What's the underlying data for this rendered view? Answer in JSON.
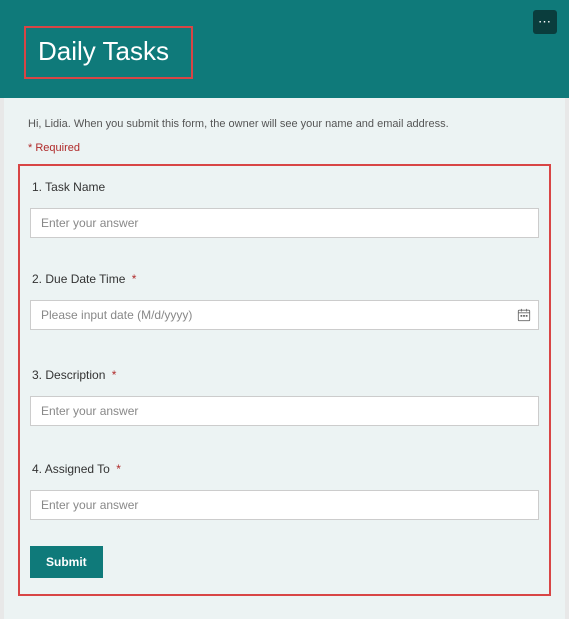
{
  "header": {
    "title": "Daily Tasks"
  },
  "form": {
    "greeting": "Hi, Lidia. When you submit this form, the owner will see your name and email address.",
    "required_note": "* Required",
    "questions": [
      {
        "num": "1.",
        "label": "Task Name",
        "required": false,
        "placeholder": "Enter your answer"
      },
      {
        "num": "2.",
        "label": "Due Date Time",
        "required": true,
        "placeholder": "Please input date (M/d/yyyy)"
      },
      {
        "num": "3.",
        "label": "Description",
        "required": true,
        "placeholder": "Enter your answer"
      },
      {
        "num": "4.",
        "label": "Assigned To",
        "required": true,
        "placeholder": "Enter your answer"
      }
    ],
    "submit_label": "Submit"
  }
}
